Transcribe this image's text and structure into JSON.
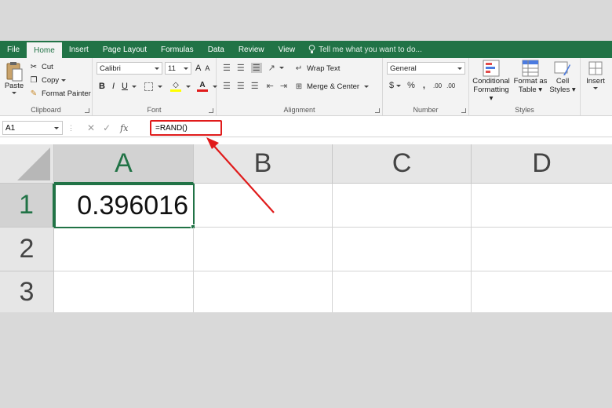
{
  "ribbon_tabs": {
    "file": "File",
    "home": "Home",
    "insert": "Insert",
    "page_layout": "Page Layout",
    "formulas": "Formulas",
    "data": "Data",
    "review": "Review",
    "view": "View",
    "tell_me": "Tell me what you want to do..."
  },
  "clipboard": {
    "paste": "Paste",
    "cut": "Cut",
    "copy": "Copy",
    "format_painter": "Format Painter",
    "label": "Clipboard"
  },
  "font": {
    "name": "Calibri",
    "size": "11",
    "bold": "B",
    "italic": "I",
    "underline": "U",
    "label": "Font",
    "grow": "A",
    "shrink": "A"
  },
  "alignment": {
    "wrap_text": "Wrap Text",
    "merge_center": "Merge & Center",
    "label": "Alignment"
  },
  "number": {
    "format": "General",
    "currency": "$",
    "percent": "%",
    "comma": ",",
    "label": "Number"
  },
  "styles": {
    "conditional": "Conditional",
    "formatting": "Formatting",
    "format_as": "Format as",
    "table": "Table",
    "cell": "Cell",
    "styles": "Styles",
    "label": "Styles"
  },
  "cells": {
    "insert": "Insert"
  },
  "formula_bar": {
    "name_box": "A1",
    "fx": "fx",
    "formula": "=RAND()"
  },
  "sheet": {
    "columns": [
      "A",
      "B",
      "C",
      "D"
    ],
    "rows": [
      "1",
      "2",
      "3"
    ],
    "a1_value": "0.396016"
  },
  "colors": {
    "excel_green": "#217346",
    "annotation_red": "#e01b1b"
  }
}
